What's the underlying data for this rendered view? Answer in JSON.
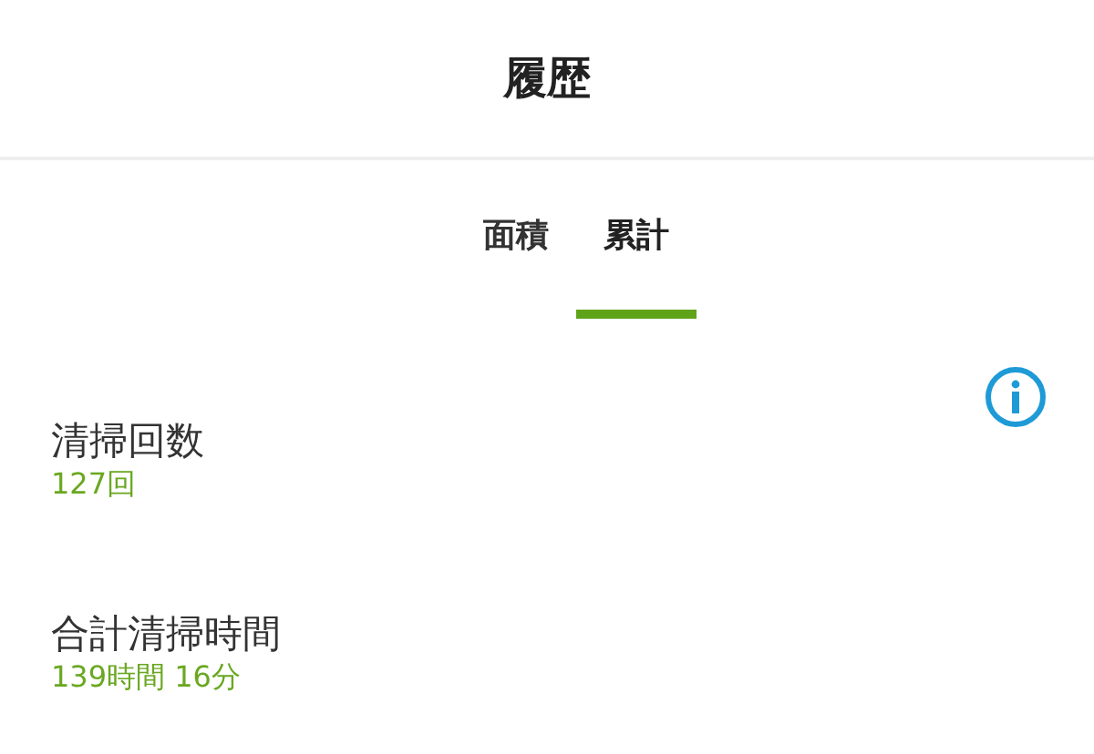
{
  "header": {
    "title": "履歴"
  },
  "tabs": [
    {
      "label": "面積",
      "selected": false
    },
    {
      "label": "累計",
      "selected": true
    }
  ],
  "stats": [
    {
      "label": "清掃回数",
      "value": "127回"
    },
    {
      "label": "合計清掃時間",
      "value": "139時間 16分"
    }
  ]
}
